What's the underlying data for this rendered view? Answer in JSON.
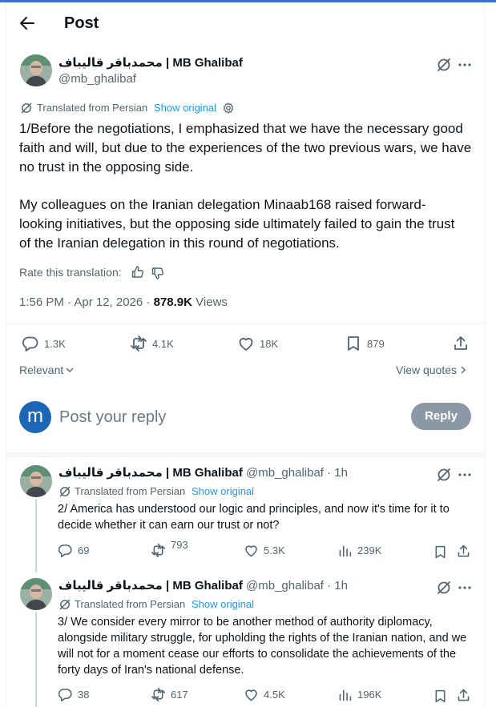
{
  "header": {
    "title": "Post"
  },
  "main_post": {
    "author_name": "محمدباقر قالیباف | MB Ghalibaf",
    "handle": "@mb_ghalibaf",
    "translated_label": "Translated from Persian",
    "show_original": "Show original",
    "paragraph1": "1/Before the negotiations, I emphasized that we have the necessary good faith and will, but due to the experiences of the two previous wars, we have no trust in the opposing side.",
    "paragraph2": "My colleagues on the Iranian delegation Minaab168 raised forward-looking initiatives, but the opposing side ultimately failed to gain the trust of the Iranian delegation in this round of negotiations.",
    "rate_label": "Rate this translation:",
    "time": "1:56 PM · Apr 12, 2026 ·",
    "views_count": "878.9K",
    "views_label": "Views",
    "replies": "1.3K",
    "reposts": "4.1K",
    "likes": "18K",
    "bookmarks": "879",
    "sort_label": "Relevant",
    "view_quotes": "View quotes"
  },
  "composer": {
    "avatar_letter": "m",
    "placeholder": "Post your reply",
    "reply_button": "Reply"
  },
  "replies": [
    {
      "author_name": "محمدباقر قالیباف | MB Ghalibaf",
      "handle_time": "@mb_ghalibaf · 1h",
      "translated_label": "Translated from Persian",
      "show_original": "Show original",
      "text": "2/ America has understood our logic and principles, and now it's time for it to decide whether it can earn our trust or not?",
      "replies": "69",
      "reposts": "793",
      "likes": "5.3K",
      "views": "239K"
    },
    {
      "author_name": "محمدباقر قالیباف | MB Ghalibaf",
      "handle_time": "@mb_ghalibaf · 1h",
      "translated_label": "Translated from Persian",
      "show_original": "Show original",
      "text": "3/ We consider every mirror to be another method of authority diplomacy, alongside military struggle, for upholding the rights of the Iranian nation, and we will not for a moment cease our efforts to consolidate the achievements of the forty days of Iran's national defense.",
      "replies": "38",
      "reposts": "617",
      "likes": "4.5K",
      "views": "196K"
    }
  ]
}
